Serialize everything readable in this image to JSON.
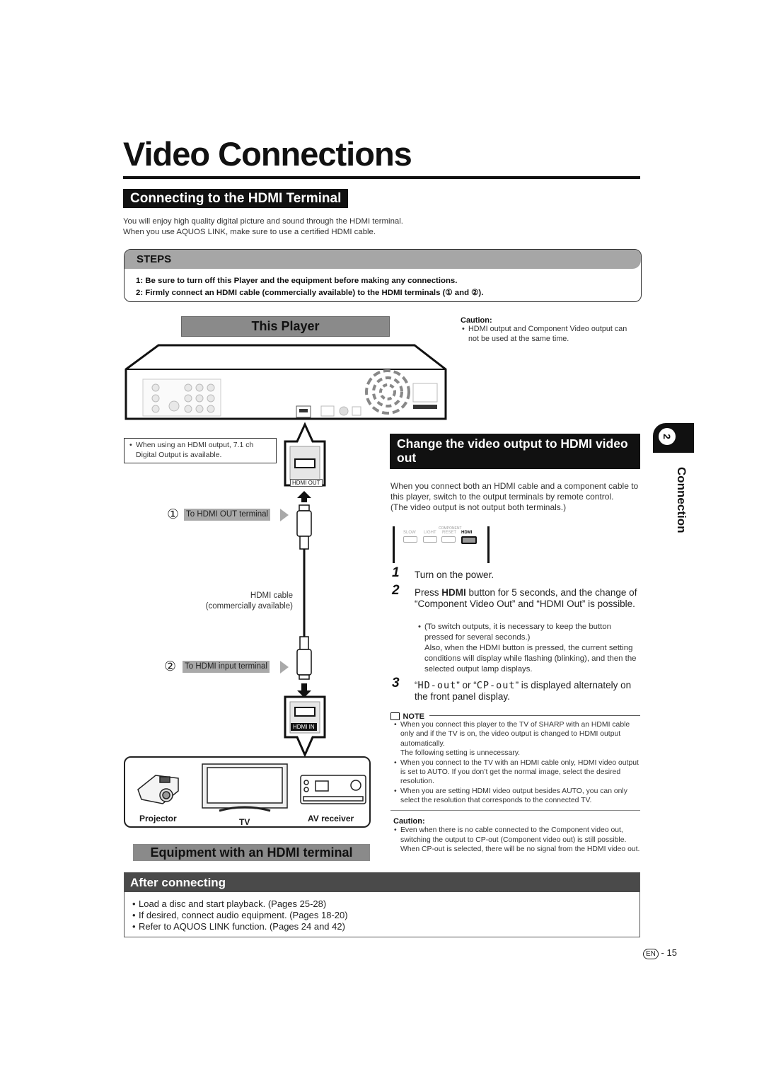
{
  "page": {
    "title": "Video Connections",
    "section_hdmi": {
      "heading": "Connecting to the HDMI Terminal",
      "intro": [
        "You will enjoy high quality digital picture and sound through the HDMI terminal.",
        "When you use AQUOS LINK, make sure to use a certified HDMI cable."
      ]
    },
    "steps": {
      "label": "STEPS",
      "items": [
        "1: Be sure to turn off this Player and the equipment before making any connections.",
        "2: Firmly connect an HDMI cable (commercially available) to the HDMI terminals (① and ②)."
      ]
    },
    "diagram": {
      "player_label": "This Player",
      "caution_title": "Caution:",
      "caution_text": "HDMI output and Component Video output can not be used at the same time.",
      "note_71": "When using an HDMI output, 7.1 ch Digital Output is available.",
      "hdmi_out_port": "HDMI OUT",
      "hdmi_in_port": "HDMI IN",
      "callout_1_num": "①",
      "callout_1": "To HDMI OUT terminal",
      "callout_2_num": "②",
      "callout_2": "To HDMI input terminal",
      "cable_label": [
        "HDMI cable",
        "(commercially available)"
      ],
      "equipment": [
        "Projector",
        "TV",
        "AV receiver"
      ],
      "equipment_label": "Equipment with an HDMI terminal"
    },
    "change_output": {
      "heading": "Change the video output to HDMI video out",
      "intro": "When you connect both an HDMI cable and a component cable to this player, switch to the output terminals by remote control.",
      "intro_note": "(The video output is not output both terminals.)",
      "remote": {
        "group_label": "COMPONENT",
        "buttons": [
          "SLOW",
          "LIGHT",
          "RESET",
          "HDMI"
        ]
      },
      "steps": [
        {
          "num": "1",
          "text": "Turn on the power."
        },
        {
          "num": "2",
          "text_pre": "Press ",
          "text_bold": "HDMI",
          "text_post": " button for 5 seconds, and the change of “Component Video Out” and “HDMI Out” is possible.",
          "bullet": "(To switch outputs, it is necessary to keep the button pressed for several seconds.)",
          "bullet_cont": "Also, when the HDMI button is pressed, the current setting conditions will display while flashing (blinking), and then the selected output lamp displays."
        },
        {
          "num": "3",
          "seg1": "HD-out",
          "seg2": "CP-out",
          "text_mid": "” or “",
          "text_post": "” is displayed alternately on the front panel display."
        }
      ],
      "note_label": "NOTE",
      "notes": [
        "When you connect this player to the TV of SHARP with an HDMI cable only and if the TV is on, the video output is changed to HDMI output automatically.",
        "The following setting is unnecessary.",
        "When you connect to the TV with an HDMI cable only, HDMI video output is set to AUTO. If you don’t get the normal image, select the desired resolution.",
        "When you are setting HDMI video output besides AUTO, you can only select the resolution that corresponds to the connected TV."
      ],
      "caution_title": "Caution:",
      "caution_text": "Even when there is no cable connected to the Component video out, switching the output to CP-out (Component video out) is still possible. When CP-out is selected, there will be no signal from the HDMI video out."
    },
    "side_tab": {
      "number": "2",
      "label": "Connection"
    },
    "after": {
      "heading": "After connecting",
      "items": [
        "Load a disc and start playback. (Pages 25-28)",
        "If desired, connect audio equipment. (Pages 18-20)",
        "Refer to AQUOS LINK function. (Pages 24 and 42)"
      ]
    },
    "footer": {
      "lang": "EN",
      "page": "- 15"
    }
  }
}
